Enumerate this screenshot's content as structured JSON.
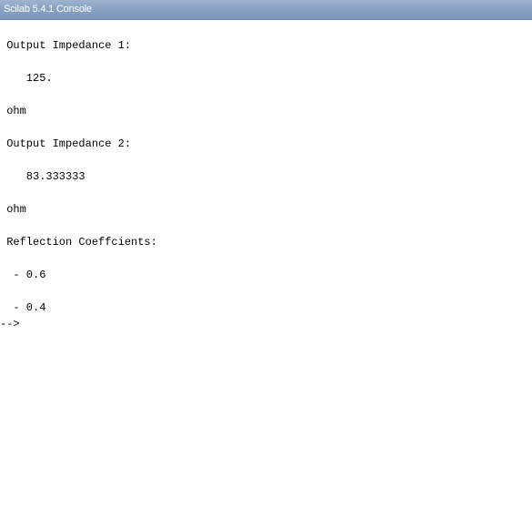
{
  "window": {
    "title": "Scilab 5.4.1 Console"
  },
  "console": {
    "lines": [
      " Output Impedance 1:",
      "    125.",
      " ohm",
      " Output Impedance 2:",
      "    83.333333",
      " ohm",
      " Reflection Coeffcients:",
      "  - 0.6",
      "  - 0.4"
    ],
    "prompt": "-->"
  }
}
